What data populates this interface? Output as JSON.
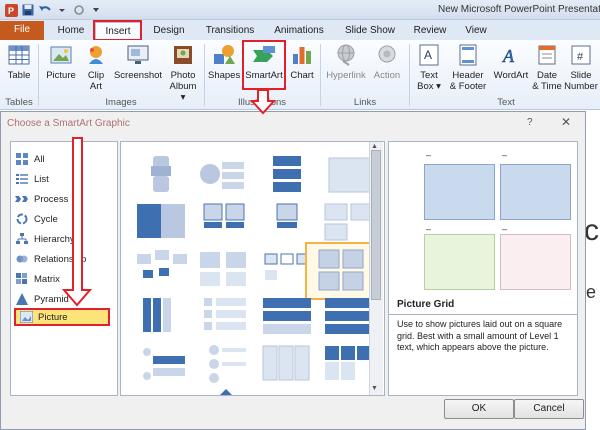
{
  "window": {
    "title": "New Microsoft PowerPoint Presentat"
  },
  "tabs": [
    "File",
    "Home",
    "Insert",
    "Design",
    "Transitions",
    "Animations",
    "Slide Show",
    "Review",
    "View"
  ],
  "ribbon": {
    "table": {
      "label1": "Table",
      "label2": ""
    },
    "picture": {
      "label1": "Picture",
      "label2": ""
    },
    "clipart": {
      "label1": "Clip",
      "label2": "Art"
    },
    "screenshot": {
      "label1": "Screenshot",
      "label2": ""
    },
    "photoalbum": {
      "label1": "Photo",
      "label2": "Album ▾"
    },
    "shapes": {
      "label1": "Shapes",
      "label2": ""
    },
    "smartart": {
      "label1": "SmartArt",
      "label2": ""
    },
    "chart": {
      "label1": "Chart",
      "label2": ""
    },
    "hyperlink": {
      "label1": "Hyperlink",
      "label2": ""
    },
    "action": {
      "label1": "Action",
      "label2": ""
    },
    "textbox": {
      "label1": "Text",
      "label2": "Box ▾"
    },
    "headerfooter": {
      "label1": "Header",
      "label2": "& Footer"
    },
    "wordart": {
      "label1": "WordArt",
      "label2": ""
    },
    "datetime": {
      "label1": "Date",
      "label2": "& Time"
    },
    "slidenumber": {
      "label1": "Slide",
      "label2": "Number"
    },
    "groups": {
      "tables": "Tables",
      "images": "Images",
      "illustrations": "Illustrations",
      "links": "Links",
      "text": "Text"
    }
  },
  "dialog": {
    "title": "Choose a SmartArt Graphic",
    "help": "?",
    "close": "✕",
    "categories": [
      "All",
      "List",
      "Process",
      "Cycle",
      "Hierarchy",
      "Relationship",
      "Matrix",
      "Pyramid",
      "Picture"
    ],
    "selected_category": "Picture",
    "preview_title": "Picture Grid",
    "preview_description": "Use to show pictures laid out on a square grid. Best with a small amount of Level 1 text, which appears above the picture.",
    "preview_dash": "–",
    "ok": "OK",
    "cancel": "Cancel"
  },
  "colors": {
    "highlight_red": "#e2202a",
    "file_tab": "#c55a1f",
    "selected_category": "#fde47a"
  }
}
